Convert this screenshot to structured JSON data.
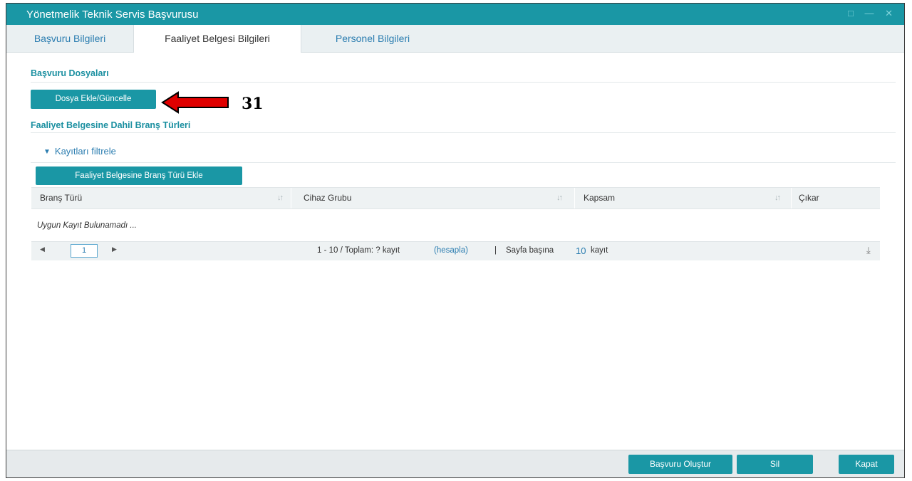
{
  "window": {
    "title": "Yönetmelik Teknik Servis Başvurusu",
    "controls": "□ — ✕"
  },
  "tabs": [
    {
      "label": "Başvuru Bilgileri"
    },
    {
      "label": "Faaliyet Belgesi Bilgileri"
    },
    {
      "label": "Personel Bilgileri"
    }
  ],
  "files_section": {
    "title": "Başvuru Dosyaları",
    "button": "Dosya Ekle/Güncelle"
  },
  "annotation": {
    "number": "31"
  },
  "branch_section": {
    "title": "Faaliyet Belgesine Dahil Branş Türleri",
    "filter_label": "Kayıtları filtrele",
    "filter_icon": "chevron-down-icon",
    "add_button": "Faaliyet Belgesine Branş Türü Ekle"
  },
  "grid": {
    "columns": [
      "Branş Türü",
      "Cihaz Grubu",
      "Kapsam",
      "Çıkar"
    ],
    "sort_icon": "↓↑",
    "empty_message": "Uygun Kayıt Bulunamadı ...",
    "pager": {
      "prev": "◀",
      "next": "▶",
      "page": "1",
      "range_text": "1 - 10 / Toplam: ? kayıt",
      "calc_link": "(hesapla)",
      "separator": "|",
      "per_page_label": "Sayfa başına",
      "per_page_value": "10",
      "per_page_suffix": "kayıt",
      "export_icon": "⤓"
    }
  },
  "footer": {
    "create": "Başvuru Oluştur",
    "delete": "Sil",
    "close": "Kapat"
  },
  "colors": {
    "accent": "#1a97a5",
    "link": "#2b7db0",
    "annotation_arrow": "#e00000"
  }
}
